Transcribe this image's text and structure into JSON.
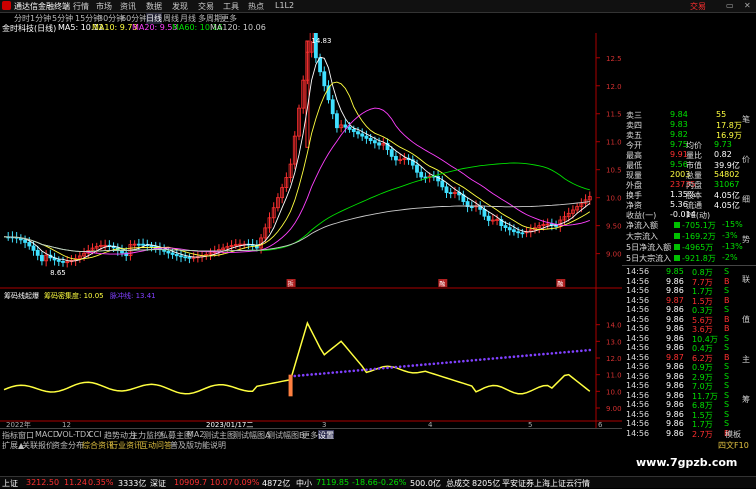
{
  "app": {
    "title": "通达信金融终端",
    "menu": [
      "行情",
      "市场",
      "资讯",
      "数据",
      "发现",
      "交易",
      "工具",
      "热点",
      "L1L2"
    ],
    "right": [
      "交易",
      "▭",
      "✕"
    ]
  },
  "periods": {
    "items": [
      "分时",
      "1分钟",
      "5分钟",
      "15分钟",
      "30分钟",
      "60分钟",
      "日线",
      "周线",
      "月线",
      "多周期",
      "更多"
    ],
    "active": 6
  },
  "ma_legend": {
    "stock": "金时科技(日线)",
    "items": [
      {
        "label": "MA5: 10.12",
        "color": "#ffffff"
      },
      {
        "label": "MA10: 9.73",
        "color": "#ffff40"
      },
      {
        "label": "MA20: 9.53",
        "color": "#ff40ff"
      },
      {
        "label": "MA60: 10.16",
        "color": "#00e000"
      },
      {
        "label": "MA120: 10.06",
        "color": "#cccccc"
      }
    ]
  },
  "chart_data": [
    {
      "type": "candlestick",
      "annotations": [
        "14.83",
        "8.65"
      ],
      "yticks": [
        "12.50",
        "12.00",
        "11.50",
        "11.00",
        "10.50",
        "10.00",
        "9.50",
        "9.00"
      ],
      "ylim": [
        8.6,
        12.8
      ],
      "markers": [
        "拆",
        "融",
        "融"
      ]
    },
    {
      "type": "line",
      "title": "筹码线起爆",
      "series": [
        {
          "name": "筹码密集度",
          "label": "筹码密集度: 10.05",
          "color": "#ffff40"
        },
        {
          "name": "脉冲线",
          "label": "脉冲线: 13.41",
          "color": "#8040ff"
        }
      ],
      "yticks": [
        "14.00",
        "13.00",
        "12.00",
        "11.00",
        "10.00",
        "9.00"
      ],
      "ylim": [
        8.7,
        15.0
      ],
      "xlabels": [
        "2022年",
        "12",
        "2023/01/17二",
        "3",
        "4",
        "5",
        "6"
      ]
    }
  ],
  "quote": {
    "rows": [
      {
        "l": "卖三",
        "v": "9.84",
        "c": "green",
        "n": "55"
      },
      {
        "l": "卖四",
        "v": "9.83",
        "c": "green",
        "n": "17.8万"
      },
      {
        "l": "卖五",
        "v": "9.82",
        "c": "green",
        "n": "16.9万"
      },
      {
        "l": "今开",
        "v": "9.75",
        "c": "green",
        "l2": "均价",
        "v2": "9.73",
        "c2": "green"
      },
      {
        "l": "最高",
        "v": "9.91",
        "c": "red",
        "l2": "量比",
        "v2": "0.82",
        "c2": "white"
      },
      {
        "l": "最低",
        "v": "9.56",
        "c": "green",
        "l2": "市值",
        "v2": "39.9亿",
        "c2": "white"
      },
      {
        "l": "现量",
        "v": "2003",
        "c": "yellow",
        "l2": "总量",
        "v2": "54802",
        "c2": "yellow"
      },
      {
        "l": "外盘",
        "v": "23735",
        "c": "red",
        "l2": "内盘",
        "v2": "31067",
        "c2": "green"
      },
      {
        "l": "换手",
        "v": "1.35%",
        "c": "white",
        "l2": "股本",
        "v2": "4.05亿",
        "c2": "white"
      },
      {
        "l": "净资",
        "v": "5.36",
        "c": "white",
        "l2": "流通",
        "v2": "4.05亿",
        "c2": "white"
      },
      {
        "l": "收益(一)",
        "v": "-0.014",
        "c": "white",
        "l2": "PE(动)",
        "v2": "",
        "c2": "white"
      }
    ],
    "flows": [
      {
        "l": "净流入额",
        "v": "-705.1万",
        "p": "-15%"
      },
      {
        "l": "大宗流入",
        "v": "-169.2万",
        "p": "-3%"
      },
      {
        "l": "5日净流入额",
        "v": "-4965万",
        "p": "-13%"
      },
      {
        "l": "5日大宗流入",
        "v": "-921.8万",
        "p": "-2%"
      }
    ]
  },
  "ticks": [
    {
      "t": "14:56",
      "p": "9.85",
      "pc": "green",
      "v": "0.8万",
      "s": "S"
    },
    {
      "t": "14:56",
      "p": "9.86",
      "pc": "white",
      "v": "7.7万",
      "s": "B"
    },
    {
      "t": "14:56",
      "p": "9.86",
      "pc": "white",
      "v": "1.7万",
      "s": "S"
    },
    {
      "t": "14:56",
      "p": "9.87",
      "pc": "red",
      "v": "1.5万",
      "s": "B"
    },
    {
      "t": "14:56",
      "p": "9.86",
      "pc": "white",
      "v": "0.3万",
      "s": "S"
    },
    {
      "t": "14:56",
      "p": "9.86",
      "pc": "white",
      "v": "5.6万",
      "s": "B"
    },
    {
      "t": "14:56",
      "p": "9.86",
      "pc": "white",
      "v": "3.6万",
      "s": "B"
    },
    {
      "t": "14:56",
      "p": "9.86",
      "pc": "white",
      "v": "10.4万",
      "s": "S"
    },
    {
      "t": "14:56",
      "p": "9.86",
      "pc": "white",
      "v": "0.4万",
      "s": "S"
    },
    {
      "t": "14:56",
      "p": "9.87",
      "pc": "red",
      "v": "6.2万",
      "s": "B"
    },
    {
      "t": "14:56",
      "p": "9.86",
      "pc": "white",
      "v": "0.9万",
      "s": "S"
    },
    {
      "t": "14:56",
      "p": "9.86",
      "pc": "white",
      "v": "2.9万",
      "s": "S"
    },
    {
      "t": "14:56",
      "p": "9.86",
      "pc": "white",
      "v": "7.0万",
      "s": "S"
    },
    {
      "t": "14:56",
      "p": "9.86",
      "pc": "white",
      "v": "11.7万",
      "s": "S"
    },
    {
      "t": "14:56",
      "p": "9.86",
      "pc": "white",
      "v": "6.8万",
      "s": "S"
    },
    {
      "t": "14:56",
      "p": "9.86",
      "pc": "white",
      "v": "1.5万",
      "s": "S"
    },
    {
      "t": "14:56",
      "p": "9.86",
      "pc": "white",
      "v": "1.7万",
      "s": "S"
    },
    {
      "t": "14:56",
      "p": "9.86",
      "pc": "white",
      "v": "2.7万",
      "s": "B"
    }
  ],
  "right_tabs": [
    "笔",
    "价",
    "细",
    "势",
    "联",
    "值",
    "主",
    "筹"
  ],
  "bottom_tabs": {
    "row1": [
      "指标",
      "窗口",
      "MACD",
      "VOL-TDX",
      "CCI",
      "趋势动力",
      "主力监控",
      "私募主图",
      "MA2",
      "测试主图",
      "测试幅图A",
      "测试幅图B",
      "更多",
      "设置"
    ],
    "row2": [
      "扩展▲",
      "关联报价",
      "资金分布",
      "综合资讯",
      "行业资讯",
      "互动问答",
      "普及版功能说明"
    ],
    "right": "模板"
  },
  "infobar": {
    "shanghai": {
      "label": "上证",
      "price": "3212.50",
      "chg": "11.24",
      "pct": "0.35%",
      "amt": "3333亿"
    },
    "shenzhen": {
      "label": "深证",
      "price": "10909.7",
      "chg": "10.07",
      "pct": "0.09%",
      "amt": "4872亿"
    },
    "smallcap": {
      "label": "中小",
      "price": "7119.85",
      "chg": "-18.66",
      "pct": "-0.26%",
      "amt": "500.0亿"
    },
    "total": {
      "label": "总成交",
      "amt": "8205亿"
    },
    "broker": "平安证券上海上证云行情",
    "corner": "四文F10"
  },
  "watermark": "www.7gpzb.com"
}
